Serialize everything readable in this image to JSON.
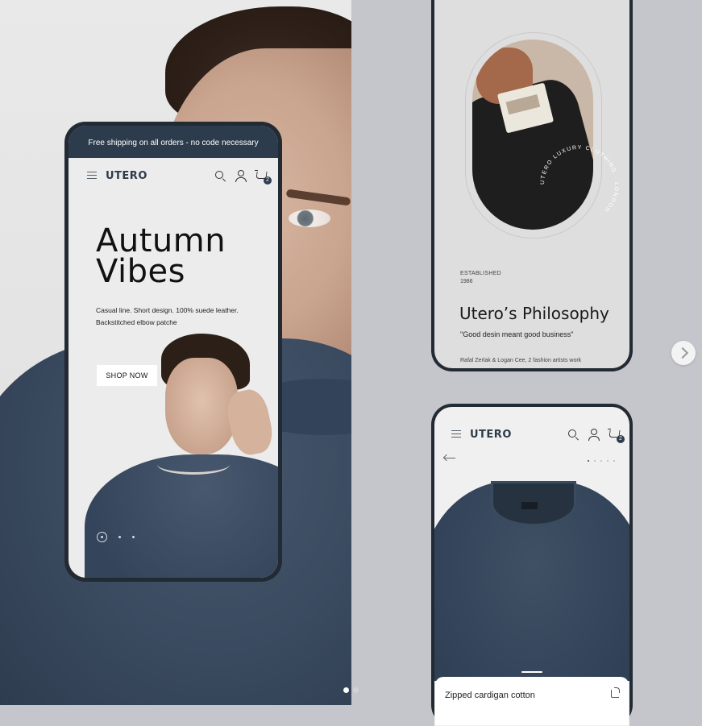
{
  "phone_home": {
    "announcement": "Free shipping on all orders - no code necessary",
    "brand": "UTERO",
    "cart_count": "2",
    "hero_title_line1": "Autumn",
    "hero_title_line2": "Vibes",
    "hero_desc_line1": "Casual line. Short design. 100% suede leather.",
    "hero_desc_line2": "Backstitched elbow patche",
    "cta_label": "SHOP NOW"
  },
  "phone_about": {
    "ring_text": "UTERO LUXURY CLOTHING · LONDON ·",
    "established_label": "ESTABLISHED",
    "established_year": "1986",
    "title": "Utero’s Philosophy",
    "quote": "\"Good desin meant good business\"",
    "credit": "Rafal Zerlak & Logan Cee, 2 fashion artists work"
  },
  "phone_product": {
    "brand": "UTERO",
    "cart_count": "2",
    "product_name": "Zipped cardigan cotton"
  },
  "colors": {
    "accent": "#2c3c4c",
    "background": "#c4c6cb"
  }
}
